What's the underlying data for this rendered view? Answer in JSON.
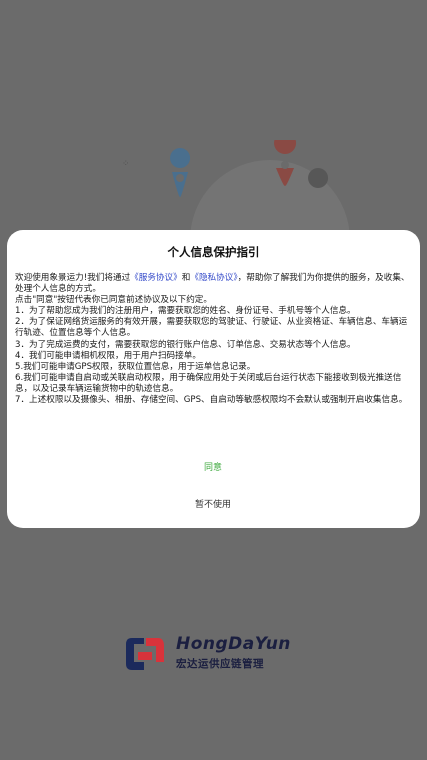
{
  "dialog": {
    "title": "个人信息保护指引",
    "intro_before_service": "欢迎使用象景运力!我们将通过",
    "service_link": "《服务协议》",
    "and": "和",
    "privacy_link": "《隐私协议》",
    "intro_after_privacy": "，帮助你了解我们为你提供的服务，及收集、处理个人信息的方式。",
    "lines": [
      "点击\"同意\"按钮代表你已同意前述协议及以下约定。",
      "1．为了帮助您成为我们的注册用户，需要获取您的姓名、身份证号、手机号等个人信息。",
      "2．为了保证网络货运服务的有效开展，需要获取您的驾驶证、行驶证、从业资格证、车辆信息、车辆运行轨迹、位置信息等个人信息。",
      "3．为了完成运费的支付，需要获取您的银行账户信息、订单信息、交易状态等个人信息。",
      "4．我们可能申请相机权限，用于用户扫码接单。",
      "5.我们可能申请GPS权限，获取位置信息，用于运单信息记录。",
      "6.我们可能申请自启动或关联启动权限，用于确保应用处于关闭或后台运行状态下能接收到极光推送信息，以及记录车辆运输货物中的轨迹信息。",
      "7．上述权限以及摄像头、相册、存储空间、GPS、自启动等敏感权限均不会默认或强制开启收集信息。"
    ],
    "agree_label": "同意",
    "decline_label": "暂不使用"
  },
  "brand": {
    "name": "HongDaYun",
    "subtitle": "宏达运供应链管理"
  },
  "colors": {
    "overlay": "#6b6b6b",
    "link": "#3349c9",
    "agree": "#3faa3f",
    "brand_red": "#d8333b",
    "brand_navy": "#1b2a5c"
  }
}
